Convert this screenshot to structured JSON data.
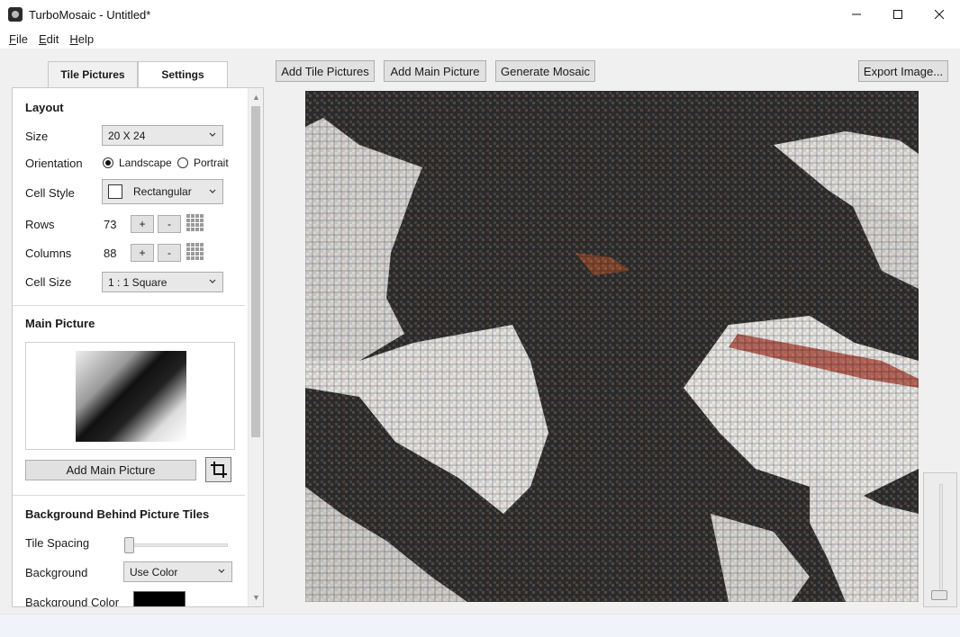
{
  "window": {
    "title": "TurboMosaic - Untitled*"
  },
  "menu": {
    "file_ul": "F",
    "file_rest": "ile",
    "edit_ul": "E",
    "edit_rest": "dit",
    "help_ul": "H",
    "help_rest": "elp"
  },
  "tabs": {
    "tile_pictures": "Tile Pictures",
    "settings": "Settings"
  },
  "layout": {
    "section_title": "Layout",
    "size_label": "Size",
    "size_value": "20 X 24",
    "orientation_label": "Orientation",
    "landscape": "Landscape",
    "portrait": "Portrait",
    "orientation_selected": "Landscape",
    "cell_style_label": "Cell Style",
    "cell_style_value": "Rectangular",
    "rows_label": "Rows",
    "rows_value": "73",
    "columns_label": "Columns",
    "columns_value": "88",
    "plus": "+",
    "minus": "-",
    "cell_size_label": "Cell Size",
    "cell_size_value": "1 : 1 Square"
  },
  "main_picture": {
    "section_title": "Main Picture",
    "add_button": "Add Main Picture"
  },
  "background": {
    "section_title": "Background Behind Picture Tiles",
    "tile_spacing_label": "Tile Spacing",
    "tile_spacing_value": 0,
    "background_label": "Background",
    "background_value": "Use Color",
    "background_color_label": "Background Color",
    "background_color": "#000000"
  },
  "toolbar": {
    "add_tile_pictures": "Add Tile Pictures",
    "add_main_picture": "Add Main Picture",
    "generate_mosaic": "Generate Mosaic",
    "export_image": "Export Image..."
  },
  "zoom": {
    "level": 0
  }
}
